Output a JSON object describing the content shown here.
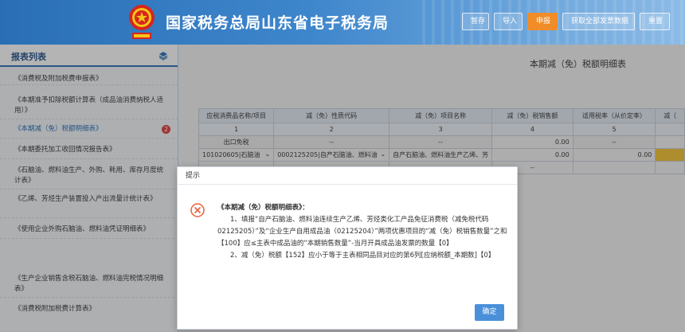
{
  "header": {
    "title": "国家税务总局山东省电子税务局",
    "buttons": [
      "暂存",
      "导入",
      "申报",
      "获取全部发票数据",
      "重置"
    ]
  },
  "sidebar": {
    "heading": "报表列表",
    "items": [
      {
        "label": "《消费税及附加税费申报表》"
      },
      {
        "label": "《本期准予扣除税额计算表（成品油消费纳税人适用）》"
      },
      {
        "label": "《本期减（免）税额明细表》",
        "badge": "2"
      },
      {
        "label": "《本期委托加工收回情况报告表》"
      },
      {
        "label": "《石脑油、燃料油生产、外购、耗用、库存月度统计表》"
      },
      {
        "label": "《乙烯、芳烃生产装置投入产出流量计统计表》"
      },
      {
        "label": "《使用企业外购石脑油、燃料油凭证明细表》"
      },
      {
        "label": "《生产企业销售含税石脑油、燃料油完税情况明细表》"
      },
      {
        "label": "《消费税附加税费计算表》"
      }
    ]
  },
  "main": {
    "title": "本期减（免）税额明细表",
    "columns": [
      "应税消费品名称/项目",
      "减（免）性质代码",
      "减（免）项目名称",
      "减（免）税销售额",
      "适用税率（从价定率）",
      "减（"
    ],
    "index_row": [
      "1",
      "2",
      "3",
      "4",
      "5",
      "—"
    ],
    "row_export": {
      "label": "出口免税",
      "col2": "--",
      "col3": "--",
      "col4": "0.00",
      "col5": "--"
    },
    "row_data": {
      "col1": "101020605|石脑油",
      "col2": "0002125205|自产石脑油、燃料油",
      "col3": "自产石脑油、燃料油生产乙烯、芳",
      "col4": "0.00",
      "col5": "0.00"
    },
    "row_partial": {
      "col4": "--"
    }
  },
  "dialog": {
    "title": "提示",
    "heading": "《本期减（免）税额明细表》：",
    "line1": "1、填报“自产石脑油、燃料油连续生产乙烯、芳烃类化工产品免征消费税（减免税代码02125205）”及“企业生产自用成品油（02125204）”两项优惠项目的“减（免）税销售数量”之和【100】应≤主表中成品油的“本期销售数量”-当月开具成品油发票的数量【0】",
    "line2": "2、减（免）税额【152】应小于等于主表相同品目对应的第6列[应纳税额_本期数]【0】",
    "ok_label": "确定"
  },
  "colors": {
    "header_blue": "#2a6fb6",
    "accent_orange": "#f08d28",
    "error_red": "#e8603c",
    "ok_blue": "#4a90d9",
    "highlight_yellow": "#f4c430"
  }
}
